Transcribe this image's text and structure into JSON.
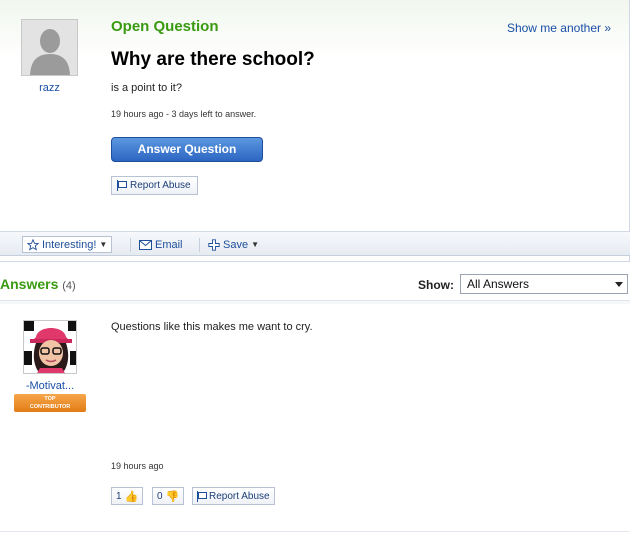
{
  "question": {
    "status": "Open Question",
    "show_another": "Show me another »",
    "title": "Why are there school?",
    "detail": "is a point to it?",
    "meta": "19 hours ago - 3 days left to answer.",
    "answer_button": "Answer Question",
    "report_abuse": "Report Abuse",
    "asker": {
      "name": "razz",
      "avatar_icon": "default-avatar-silhouette"
    }
  },
  "actions": {
    "interesting": "Interesting!",
    "email": "Email",
    "save": "Save"
  },
  "answers": {
    "heading": "Answers",
    "count": "(4)",
    "show_label": "Show:",
    "filter_selected": "All Answers",
    "items": [
      {
        "author": "-Motivat...",
        "badge_line1": "TOP",
        "badge_line2": "CONTRIBUTOR",
        "text": "Questions like this makes me want to cry.",
        "time": "19 hours ago",
        "thumbs_up": "1",
        "thumbs_down": "0",
        "report_abuse": "Report Abuse"
      }
    ]
  },
  "colors": {
    "status_green": "#3a9a12",
    "link_blue": "#1a4fa6",
    "button_blue": "#2c66c2",
    "badge_orange": "#e27c16"
  }
}
